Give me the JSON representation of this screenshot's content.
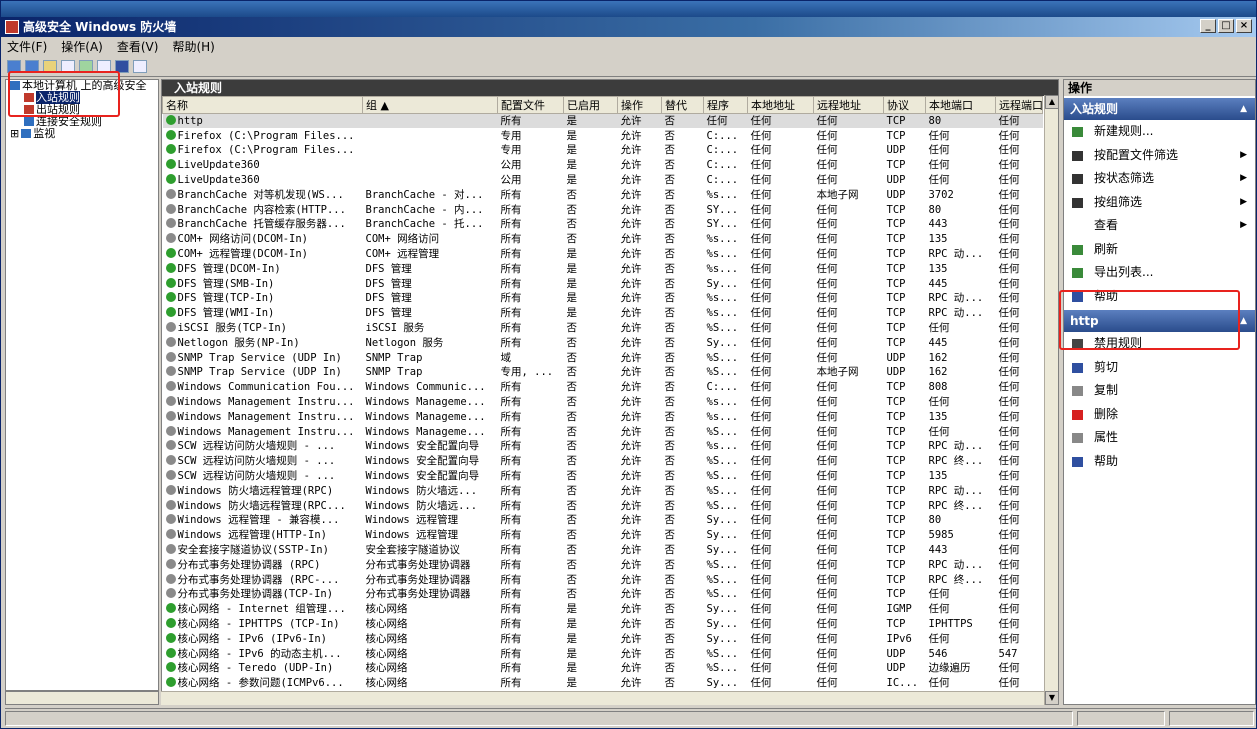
{
  "window": {
    "title": "高级安全 Windows 防火墙",
    "min": "_",
    "max": "□",
    "close": "×"
  },
  "menu": [
    "文件(F)",
    "操作(A)",
    "查看(V)",
    "帮助(H)"
  ],
  "tree": [
    {
      "label": "本地计算机 上的高级安全",
      "indent": 0,
      "selected": false,
      "color": "#2f6fbf"
    },
    {
      "label": "入站规则",
      "indent": 1,
      "selected": true,
      "color": "#c0392b"
    },
    {
      "label": "出站规则",
      "indent": 1,
      "selected": false,
      "color": "#c0392b"
    },
    {
      "label": "连接安全规则",
      "indent": 1,
      "selected": false,
      "color": "#2f6fbf"
    },
    {
      "label": "监视",
      "indent": 0,
      "selected": false,
      "color": "#2f6fbf",
      "expander": "⊞"
    }
  ],
  "center": {
    "title": "入站规则",
    "columns": [
      "名称",
      "组 ▲",
      "配置文件",
      "已启用",
      "操作",
      "替代",
      "程序",
      "本地地址",
      "远程地址",
      "协议",
      "本地端口",
      "远程端口"
    ],
    "rows": [
      [
        "on",
        "http",
        "",
        "所有",
        "是",
        "允许",
        "否",
        "任何",
        "任何",
        "任何",
        "TCP",
        "80",
        "任何"
      ],
      [
        "on",
        "Firefox (C:\\Program Files...",
        "",
        "专用",
        "是",
        "允许",
        "否",
        "C:...",
        "任何",
        "任何",
        "TCP",
        "任何",
        "任何"
      ],
      [
        "on",
        "Firefox (C:\\Program Files...",
        "",
        "专用",
        "是",
        "允许",
        "否",
        "C:...",
        "任何",
        "任何",
        "UDP",
        "任何",
        "任何"
      ],
      [
        "on",
        "LiveUpdate360",
        "",
        "公用",
        "是",
        "允许",
        "否",
        "C:...",
        "任何",
        "任何",
        "TCP",
        "任何",
        "任何"
      ],
      [
        "on",
        "LiveUpdate360",
        "",
        "公用",
        "是",
        "允许",
        "否",
        "C:...",
        "任何",
        "任何",
        "UDP",
        "任何",
        "任何"
      ],
      [
        "off",
        "BranchCache 对等机发现(WS...",
        "BranchCache - 对...",
        "所有",
        "否",
        "允许",
        "否",
        "%s...",
        "任何",
        "本地子网",
        "UDP",
        "3702",
        "任何"
      ],
      [
        "off",
        "BranchCache 内容检索(HTTP...",
        "BranchCache - 内...",
        "所有",
        "否",
        "允许",
        "否",
        "SY...",
        "任何",
        "任何",
        "TCP",
        "80",
        "任何"
      ],
      [
        "off",
        "BranchCache 托管缓存服务器...",
        "BranchCache - 托...",
        "所有",
        "否",
        "允许",
        "否",
        "SY...",
        "任何",
        "任何",
        "TCP",
        "443",
        "任何"
      ],
      [
        "off",
        "COM+ 网络访问(DCOM-In)",
        "COM+ 网络访问",
        "所有",
        "否",
        "允许",
        "否",
        "%s...",
        "任何",
        "任何",
        "TCP",
        "135",
        "任何"
      ],
      [
        "on",
        "COM+ 远程管理(DCOM-In)",
        "COM+ 远程管理",
        "所有",
        "是",
        "允许",
        "否",
        "%s...",
        "任何",
        "任何",
        "TCP",
        "RPC 动...",
        "任何"
      ],
      [
        "on",
        "DFS 管理(DCOM-In)",
        "DFS 管理",
        "所有",
        "是",
        "允许",
        "否",
        "%s...",
        "任何",
        "任何",
        "TCP",
        "135",
        "任何"
      ],
      [
        "on",
        "DFS 管理(SMB-In)",
        "DFS 管理",
        "所有",
        "是",
        "允许",
        "否",
        "Sy...",
        "任何",
        "任何",
        "TCP",
        "445",
        "任何"
      ],
      [
        "on",
        "DFS 管理(TCP-In)",
        "DFS 管理",
        "所有",
        "是",
        "允许",
        "否",
        "%s...",
        "任何",
        "任何",
        "TCP",
        "RPC 动...",
        "任何"
      ],
      [
        "on",
        "DFS 管理(WMI-In)",
        "DFS 管理",
        "所有",
        "是",
        "允许",
        "否",
        "%s...",
        "任何",
        "任何",
        "TCP",
        "RPC 动...",
        "任何"
      ],
      [
        "off",
        "iSCSI 服务(TCP-In)",
        "iSCSI 服务",
        "所有",
        "否",
        "允许",
        "否",
        "%S...",
        "任何",
        "任何",
        "TCP",
        "任何",
        "任何"
      ],
      [
        "off",
        "Netlogon 服务(NP-In)",
        "Netlogon 服务",
        "所有",
        "否",
        "允许",
        "否",
        "Sy...",
        "任何",
        "任何",
        "TCP",
        "445",
        "任何"
      ],
      [
        "off",
        "SNMP Trap Service (UDP In)",
        "SNMP Trap",
        "域",
        "否",
        "允许",
        "否",
        "%S...",
        "任何",
        "任何",
        "UDP",
        "162",
        "任何"
      ],
      [
        "off",
        "SNMP Trap Service (UDP In)",
        "SNMP Trap",
        "专用, ...",
        "否",
        "允许",
        "否",
        "%S...",
        "任何",
        "本地子网",
        "UDP",
        "162",
        "任何"
      ],
      [
        "off",
        "Windows Communication Fou...",
        "Windows Communic...",
        "所有",
        "否",
        "允许",
        "否",
        "C:...",
        "任何",
        "任何",
        "TCP",
        "808",
        "任何"
      ],
      [
        "off",
        "Windows Management Instru...",
        "Windows Manageme...",
        "所有",
        "否",
        "允许",
        "否",
        "%s...",
        "任何",
        "任何",
        "TCP",
        "任何",
        "任何"
      ],
      [
        "off",
        "Windows Management Instru...",
        "Windows Manageme...",
        "所有",
        "否",
        "允许",
        "否",
        "%s...",
        "任何",
        "任何",
        "TCP",
        "135",
        "任何"
      ],
      [
        "off",
        "Windows Management Instru...",
        "Windows Manageme...",
        "所有",
        "否",
        "允许",
        "否",
        "%S...",
        "任何",
        "任何",
        "TCP",
        "任何",
        "任何"
      ],
      [
        "off",
        "SCW 远程访问防火墙规则 - ...",
        "Windows 安全配置向导",
        "所有",
        "否",
        "允许",
        "否",
        "%s...",
        "任何",
        "任何",
        "TCP",
        "RPC 动...",
        "任何"
      ],
      [
        "off",
        "SCW 远程访问防火墙规则 - ...",
        "Windows 安全配置向导",
        "所有",
        "否",
        "允许",
        "否",
        "%S...",
        "任何",
        "任何",
        "TCP",
        "RPC 终...",
        "任何"
      ],
      [
        "off",
        "SCW 远程访问防火墙规则 - ...",
        "Windows 安全配置向导",
        "所有",
        "否",
        "允许",
        "否",
        "%S...",
        "任何",
        "任何",
        "TCP",
        "135",
        "任何"
      ],
      [
        "off",
        "Windows 防火墙远程管理(RPC)",
        "Windows 防火墙远...",
        "所有",
        "否",
        "允许",
        "否",
        "%S...",
        "任何",
        "任何",
        "TCP",
        "RPC 动...",
        "任何"
      ],
      [
        "off",
        "Windows 防火墙远程管理(RPC...",
        "Windows 防火墙远...",
        "所有",
        "否",
        "允许",
        "否",
        "%S...",
        "任何",
        "任何",
        "TCP",
        "RPC 终...",
        "任何"
      ],
      [
        "off",
        "Windows 远程管理 - 兼容模...",
        "Windows 远程管理",
        "所有",
        "否",
        "允许",
        "否",
        "Sy...",
        "任何",
        "任何",
        "TCP",
        "80",
        "任何"
      ],
      [
        "off",
        "Windows 远程管理(HTTP-In)",
        "Windows 远程管理",
        "所有",
        "否",
        "允许",
        "否",
        "Sy...",
        "任何",
        "任何",
        "TCP",
        "5985",
        "任何"
      ],
      [
        "off",
        "安全套接字隧道协议(SSTP-In)",
        "安全套接字隧道协议",
        "所有",
        "否",
        "允许",
        "否",
        "Sy...",
        "任何",
        "任何",
        "TCP",
        "443",
        "任何"
      ],
      [
        "off",
        "分布式事务处理协调器 (RPC)",
        "分布式事务处理协调器",
        "所有",
        "否",
        "允许",
        "否",
        "%S...",
        "任何",
        "任何",
        "TCP",
        "RPC 动...",
        "任何"
      ],
      [
        "off",
        "分布式事务处理协调器 (RPC-...",
        "分布式事务处理协调器",
        "所有",
        "否",
        "允许",
        "否",
        "%S...",
        "任何",
        "任何",
        "TCP",
        "RPC 终...",
        "任何"
      ],
      [
        "off",
        "分布式事务处理协调器(TCP-In)",
        "分布式事务处理协调器",
        "所有",
        "否",
        "允许",
        "否",
        "%S...",
        "任何",
        "任何",
        "TCP",
        "任何",
        "任何"
      ],
      [
        "on",
        "核心网络 - Internet 组管理...",
        "核心网络",
        "所有",
        "是",
        "允许",
        "否",
        "Sy...",
        "任何",
        "任何",
        "IGMP",
        "任何",
        "任何"
      ],
      [
        "on",
        "核心网络 - IPHTTPS (TCP-In)",
        "核心网络",
        "所有",
        "是",
        "允许",
        "否",
        "Sy...",
        "任何",
        "任何",
        "TCP",
        "IPHTTPS",
        "任何"
      ],
      [
        "on",
        "核心网络 - IPv6 (IPv6-In)",
        "核心网络",
        "所有",
        "是",
        "允许",
        "否",
        "Sy...",
        "任何",
        "任何",
        "IPv6",
        "任何",
        "任何"
      ],
      [
        "on",
        "核心网络 - IPv6 的动态主机...",
        "核心网络",
        "所有",
        "是",
        "允许",
        "否",
        "%S...",
        "任何",
        "任何",
        "UDP",
        "546",
        "547"
      ],
      [
        "on",
        "核心网络 - Teredo (UDP-In)",
        "核心网络",
        "所有",
        "是",
        "允许",
        "否",
        "%S...",
        "任何",
        "任何",
        "UDP",
        "边缘遍历",
        "任何"
      ],
      [
        "on",
        "核心网络 - 参数问题(ICMPv6...",
        "核心网络",
        "所有",
        "是",
        "允许",
        "否",
        "Sy...",
        "任何",
        "任何",
        "IC...",
        "任何",
        "任何"
      ]
    ]
  },
  "actions": {
    "title": "操作",
    "section1": {
      "title": "入站规则",
      "toggle": "▲",
      "items": [
        {
          "label": "新建规则...",
          "icon": "new-rule-icon",
          "color": "#3a8a3a",
          "arrow": ""
        },
        {
          "label": "按配置文件筛选",
          "icon": "filter-icon",
          "color": "#333333",
          "arrow": "▶"
        },
        {
          "label": "按状态筛选",
          "icon": "filter-icon",
          "color": "#333333",
          "arrow": "▶"
        },
        {
          "label": "按组筛选",
          "icon": "filter-icon",
          "color": "#333333",
          "arrow": "▶"
        },
        {
          "label": "查看",
          "icon": "",
          "color": "",
          "arrow": "▶"
        },
        {
          "label": "刷新",
          "icon": "refresh-icon",
          "color": "#3a8a3a",
          "arrow": ""
        },
        {
          "label": "导出列表...",
          "icon": "export-icon",
          "color": "#3a8a3a",
          "arrow": ""
        },
        {
          "label": "帮助",
          "icon": "help-icon",
          "color": "#2f4fa0",
          "arrow": ""
        }
      ]
    },
    "section2": {
      "title": "http",
      "toggle": "▲",
      "items": [
        {
          "label": "禁用规则",
          "icon": "disable-icon",
          "color": "#444444"
        },
        {
          "label": "剪切",
          "icon": "cut-icon",
          "color": "#2f4fa0"
        },
        {
          "label": "复制",
          "icon": "copy-icon",
          "color": "#888888"
        },
        {
          "label": "删除",
          "icon": "delete-icon",
          "color": "#d62020"
        },
        {
          "label": "属性",
          "icon": "properties-icon",
          "color": "#888888"
        },
        {
          "label": "帮助",
          "icon": "help-icon",
          "color": "#2f4fa0"
        }
      ]
    }
  },
  "colors": {
    "highlight": "#e8231e",
    "titlebar": "#0a246a",
    "enabled": "#2e9e2e",
    "disabled": "#8a8a8a"
  }
}
